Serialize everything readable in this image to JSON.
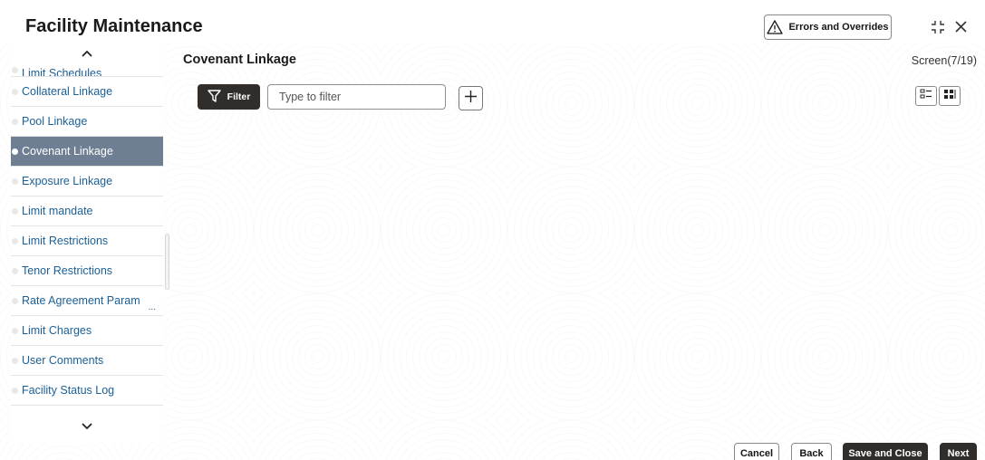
{
  "header": {
    "title": "Facility Maintenance",
    "errors_label": "Errors and Overrides"
  },
  "sidebar": {
    "items": [
      {
        "label": "Limit Schedules",
        "active": false
      },
      {
        "label": "Collateral Linkage",
        "active": false
      },
      {
        "label": "Pool Linkage",
        "active": false
      },
      {
        "label": "Covenant Linkage",
        "active": true
      },
      {
        "label": "Exposure Linkage",
        "active": false
      },
      {
        "label": "Limit mandate",
        "active": false
      },
      {
        "label": "Limit Restrictions",
        "active": false
      },
      {
        "label": "Tenor Restrictions",
        "active": false
      },
      {
        "label": "Rate Agreement Param",
        "active": false
      },
      {
        "label": "Limit Charges",
        "active": false
      },
      {
        "label": "User Comments",
        "active": false
      },
      {
        "label": "Facility Status Log",
        "active": false
      }
    ],
    "truncation": "..."
  },
  "main": {
    "section_title": "Covenant Linkage",
    "screen_count": "Screen(7/19)",
    "filter_label": "Filter",
    "filter_placeholder": "Type to filter"
  },
  "footer": {
    "cancel": "Cancel",
    "back": "Back",
    "save_close": "Save and Close",
    "next": "Next"
  },
  "colors": {
    "active_item_bg": "#6e7f93",
    "link": "#1a5f96",
    "dark_button": "#312d2a"
  },
  "icons": {
    "errors": "warning-triangle-icon",
    "collapse": "collapse-icon",
    "close": "close-icon",
    "nav_up": "chevron-up-icon",
    "nav_down": "chevron-down-icon",
    "filter": "filter-funnel-icon",
    "add": "plus-icon",
    "list_view": "list-view-icon",
    "grid_view": "grid-view-icon"
  }
}
